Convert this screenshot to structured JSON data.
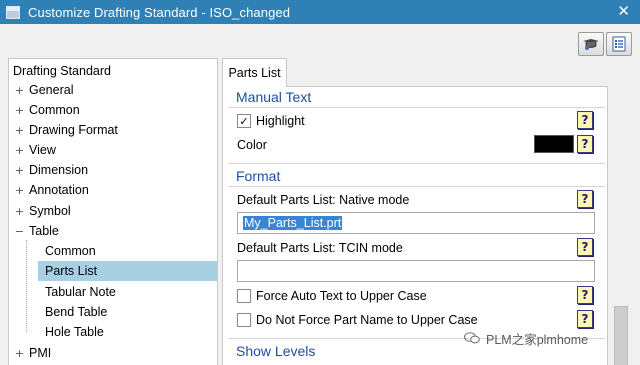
{
  "window": {
    "title": "Customize Drafting Standard - ISO_changed",
    "close_glyph": "✕"
  },
  "toolbar": [
    {
      "icon": "load-standard-icon"
    },
    {
      "icon": "settings-list-icon"
    }
  ],
  "tree": {
    "header": "Drafting Standard",
    "items": [
      {
        "label": "General",
        "expander": "+"
      },
      {
        "label": "Common",
        "expander": "+"
      },
      {
        "label": "Drawing Format",
        "expander": "+"
      },
      {
        "label": "View",
        "expander": "+"
      },
      {
        "label": "Dimension",
        "expander": "+"
      },
      {
        "label": "Annotation",
        "expander": "+"
      },
      {
        "label": "Symbol",
        "expander": "+"
      },
      {
        "label": "Table",
        "expander": "−"
      },
      {
        "label": "PMI",
        "expander": "+"
      }
    ],
    "table_children": [
      {
        "label": "Common",
        "selected": false
      },
      {
        "label": "Parts List",
        "selected": true
      },
      {
        "label": "Tabular Note",
        "selected": false
      },
      {
        "label": "Bend Table",
        "selected": false
      },
      {
        "label": "Hole Table",
        "selected": false
      }
    ]
  },
  "tab": {
    "label": "Parts List"
  },
  "content": {
    "manual_text": {
      "title": "Manual Text",
      "highlight_label": "Highlight",
      "highlight_checked": true,
      "color_label": "Color",
      "color_value": "#000000"
    },
    "format": {
      "title": "Format",
      "native_label": "Default Parts List: Native mode",
      "native_value": "My_Parts_List.prt",
      "tcin_label": "Default Parts List: TCIN mode",
      "tcin_value": "",
      "force_upper_label": "Force Auto Text to Upper Case",
      "force_upper_checked": false,
      "no_force_label": "Do Not Force Part Name to Upper Case",
      "no_force_checked": false
    },
    "show_levels": {
      "title": "Show Levels"
    },
    "help_glyph": "?",
    "check_glyph": "✓"
  },
  "watermark": {
    "text": "PLM之家plmhome"
  },
  "colors": {
    "titlebar": "#2f80b4",
    "selection": "#a8d0e4",
    "section_title": "#1f4e9a",
    "field_highlight": "#3a84d6"
  }
}
